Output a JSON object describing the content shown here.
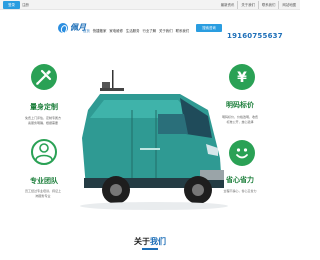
{
  "topbar": {
    "login": "登录",
    "register": "注册",
    "links": [
      "最新资讯",
      "关于我们",
      "联系我们",
      "网站地图"
    ]
  },
  "header": {
    "logo_text": "佩月",
    "nav": [
      "首页",
      "快捷搬家",
      "家电维修",
      "生活服务",
      "行业了解",
      "关于我们",
      "联系我们"
    ],
    "search_label": "搜索咨询",
    "phone": "19160755637"
  },
  "features": {
    "custom": {
      "title": "量身定制",
      "desc": "免费上门评估，定制专属方案服务明确，根据需要"
    },
    "price": {
      "title": "明码标价",
      "desc": "明码标价，价格透明，收费标准公开，放心选择"
    },
    "team": {
      "title": "专业团队",
      "desc": "员工经过专业培训，持证上岗服务专业"
    },
    "save": {
      "title": "省心省力",
      "desc": "全程不操心，省心又省力"
    }
  },
  "section": {
    "title_prefix": "关于",
    "title_accent": "我们"
  },
  "colors": {
    "accent": "#1e6fb8",
    "green": "#2aa155",
    "van": "#2f9a93"
  }
}
